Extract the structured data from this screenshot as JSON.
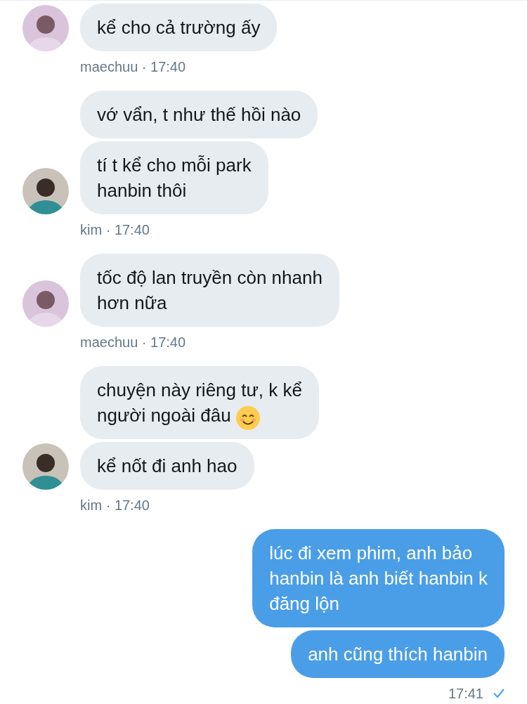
{
  "groups": [
    {
      "kind": "received",
      "messages": [
        {
          "text": "kể cho cả trường ấy"
        }
      ],
      "meta": "maechuu · 17:40"
    },
    {
      "kind": "received",
      "messages": [
        {
          "text": "vớ vẩn, t như thế hồi nào"
        },
        {
          "text": "tí t kể cho mỗi park\nhanbin thôi"
        }
      ],
      "meta": "kim · 17:40"
    },
    {
      "kind": "received",
      "messages": [
        {
          "text": "tốc độ lan truyền còn nhanh\nhơn nữa"
        }
      ],
      "meta": "maechuu · 17:40"
    },
    {
      "kind": "received",
      "messages": [
        {
          "text": "chuyện này riêng tư, k kể\nngười ngoài đâu",
          "smiley": true
        },
        {
          "text": "kể nốt đi anh hao"
        }
      ],
      "meta": "kim · 17:40"
    },
    {
      "kind": "sent",
      "messages": [
        {
          "text": "lúc đi xem phim, anh bảo\nhanbin là anh biết hanbin k\nđăng lộn"
        },
        {
          "text": "anh cũng thích hanbin"
        }
      ],
      "meta": "17:41",
      "read": true
    }
  ]
}
